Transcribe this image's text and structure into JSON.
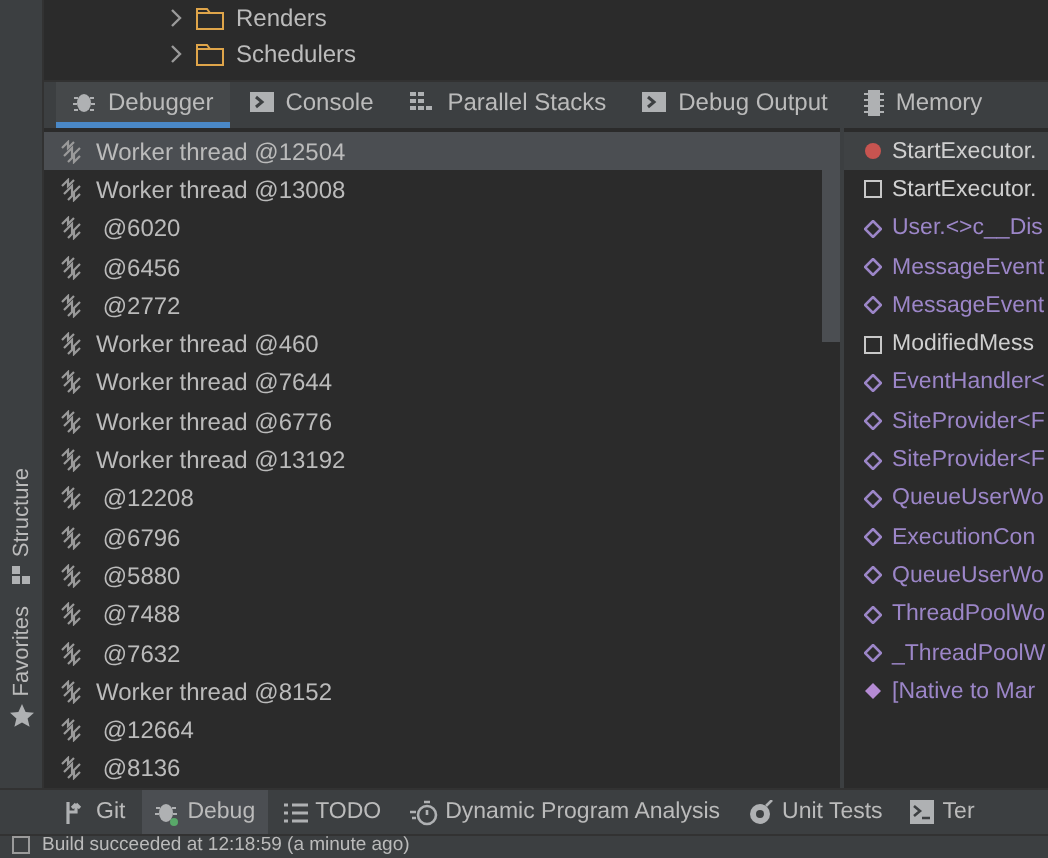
{
  "side_tabs": [
    {
      "label": "Structure"
    },
    {
      "label": "Favorites"
    }
  ],
  "tree": [
    {
      "label": "Renders",
      "expanded": false
    },
    {
      "label": "Schedulers",
      "expanded": false
    }
  ],
  "debug_tabs": [
    {
      "label": "Debugger",
      "selected": true
    },
    {
      "label": "Console",
      "selected": false
    },
    {
      "label": "Parallel Stacks",
      "selected": false
    },
    {
      "label": "Debug Output",
      "selected": false
    },
    {
      "label": "Memory",
      "selected": false
    }
  ],
  "threads": [
    {
      "label": "Worker thread @12504",
      "selected": true
    },
    {
      "label": "Worker thread @13008",
      "selected": false
    },
    {
      "label": " @6020",
      "selected": false
    },
    {
      "label": " @6456",
      "selected": false
    },
    {
      "label": " @2772",
      "selected": false
    },
    {
      "label": "Worker thread @460",
      "selected": false
    },
    {
      "label": "Worker thread @7644",
      "selected": false
    },
    {
      "label": "Worker thread @6776",
      "selected": false
    },
    {
      "label": "Worker thread @13192",
      "selected": false
    },
    {
      "label": " @12208",
      "selected": false
    },
    {
      "label": " @6796",
      "selected": false
    },
    {
      "label": " @5880",
      "selected": false
    },
    {
      "label": " @7488",
      "selected": false
    },
    {
      "label": " @7632",
      "selected": false
    },
    {
      "label": "Worker thread @8152",
      "selected": false
    },
    {
      "label": " @12664",
      "selected": false
    },
    {
      "label": " @8136",
      "selected": false
    }
  ],
  "frames": [
    {
      "label": "StartExecutor.",
      "kind": "current",
      "selected": true
    },
    {
      "label": "StartExecutor.",
      "kind": "user",
      "selected": false
    },
    {
      "label": "User.<>c__Dis",
      "kind": "external",
      "selected": false
    },
    {
      "label": "MessageEvent",
      "kind": "external",
      "selected": false
    },
    {
      "label": "MessageEvent",
      "kind": "external",
      "selected": false
    },
    {
      "label": "ModifiedMess",
      "kind": "user",
      "selected": false
    },
    {
      "label": "EventHandler<",
      "kind": "external",
      "selected": false
    },
    {
      "label": "SiteProvider<F",
      "kind": "external",
      "selected": false
    },
    {
      "label": "SiteProvider<F",
      "kind": "external",
      "selected": false
    },
    {
      "label": "QueueUserWo",
      "kind": "external",
      "selected": false
    },
    {
      "label": "ExecutionCon",
      "kind": "external",
      "selected": false
    },
    {
      "label": "QueueUserWo",
      "kind": "external",
      "selected": false
    },
    {
      "label": "ThreadPoolWo",
      "kind": "external",
      "selected": false
    },
    {
      "label": "_ThreadPoolW",
      "kind": "external",
      "selected": false
    },
    {
      "label": "[Native to Mar",
      "kind": "native",
      "selected": false
    }
  ],
  "bottom_tabs": [
    {
      "label": "Git",
      "selected": false
    },
    {
      "label": "Debug",
      "selected": true
    },
    {
      "label": "TODO",
      "selected": false
    },
    {
      "label": "Dynamic Program Analysis",
      "selected": false
    },
    {
      "label": "Unit Tests",
      "selected": false
    },
    {
      "label": "Ter",
      "selected": false
    }
  ],
  "status_bar": "Build succeeded at 12:18:59 (a minute ago)"
}
